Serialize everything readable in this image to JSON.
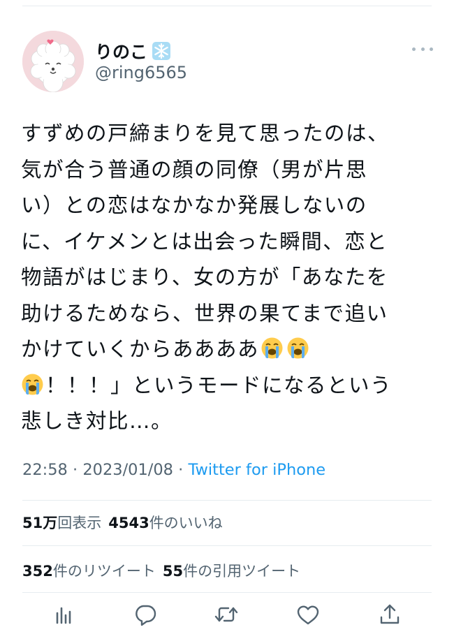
{
  "author": {
    "display_name": "りのこ",
    "handle": "@ring6565",
    "avatar_icon": "dog-avatar-icon",
    "name_emoji_icon": "snowflake-icon"
  },
  "tweet": {
    "lines": [
      "すずめの戸締まりを見て思ったのは、",
      "気が合う普通の顔の同僚（男が片思",
      "い）との恋はなかなか発展しないの",
      "に、イケメンとは出会った瞬間、恋と",
      "物語がはじまり、女の方が「あなたを",
      "助けるためなら、世界の果てまで追い",
      "かけていくからああああ",
      "！！！」というモードになるという",
      "悲しき対比…。"
    ],
    "emoji_icon": "loudly-crying-face-icon"
  },
  "meta": {
    "time": "22:58",
    "separator": " · ",
    "date": "2023/01/08",
    "source": "Twitter for iPhone"
  },
  "stats": {
    "views_count": "51万",
    "views_label": "回表示",
    "likes_count": "4543",
    "likes_label": "件のいいね",
    "retweets_count": "352",
    "retweets_label": "件のリツイート",
    "quotes_count": "55",
    "quotes_label": "件の引用ツイート"
  },
  "colors": {
    "text": "#0f1419",
    "secondary": "#536471",
    "link": "#1d9bf0",
    "divider": "#e6ecf0",
    "action_icon": "#536471"
  },
  "actions": [
    "analytics-icon",
    "reply-icon",
    "retweet-icon",
    "like-icon",
    "share-icon"
  ]
}
